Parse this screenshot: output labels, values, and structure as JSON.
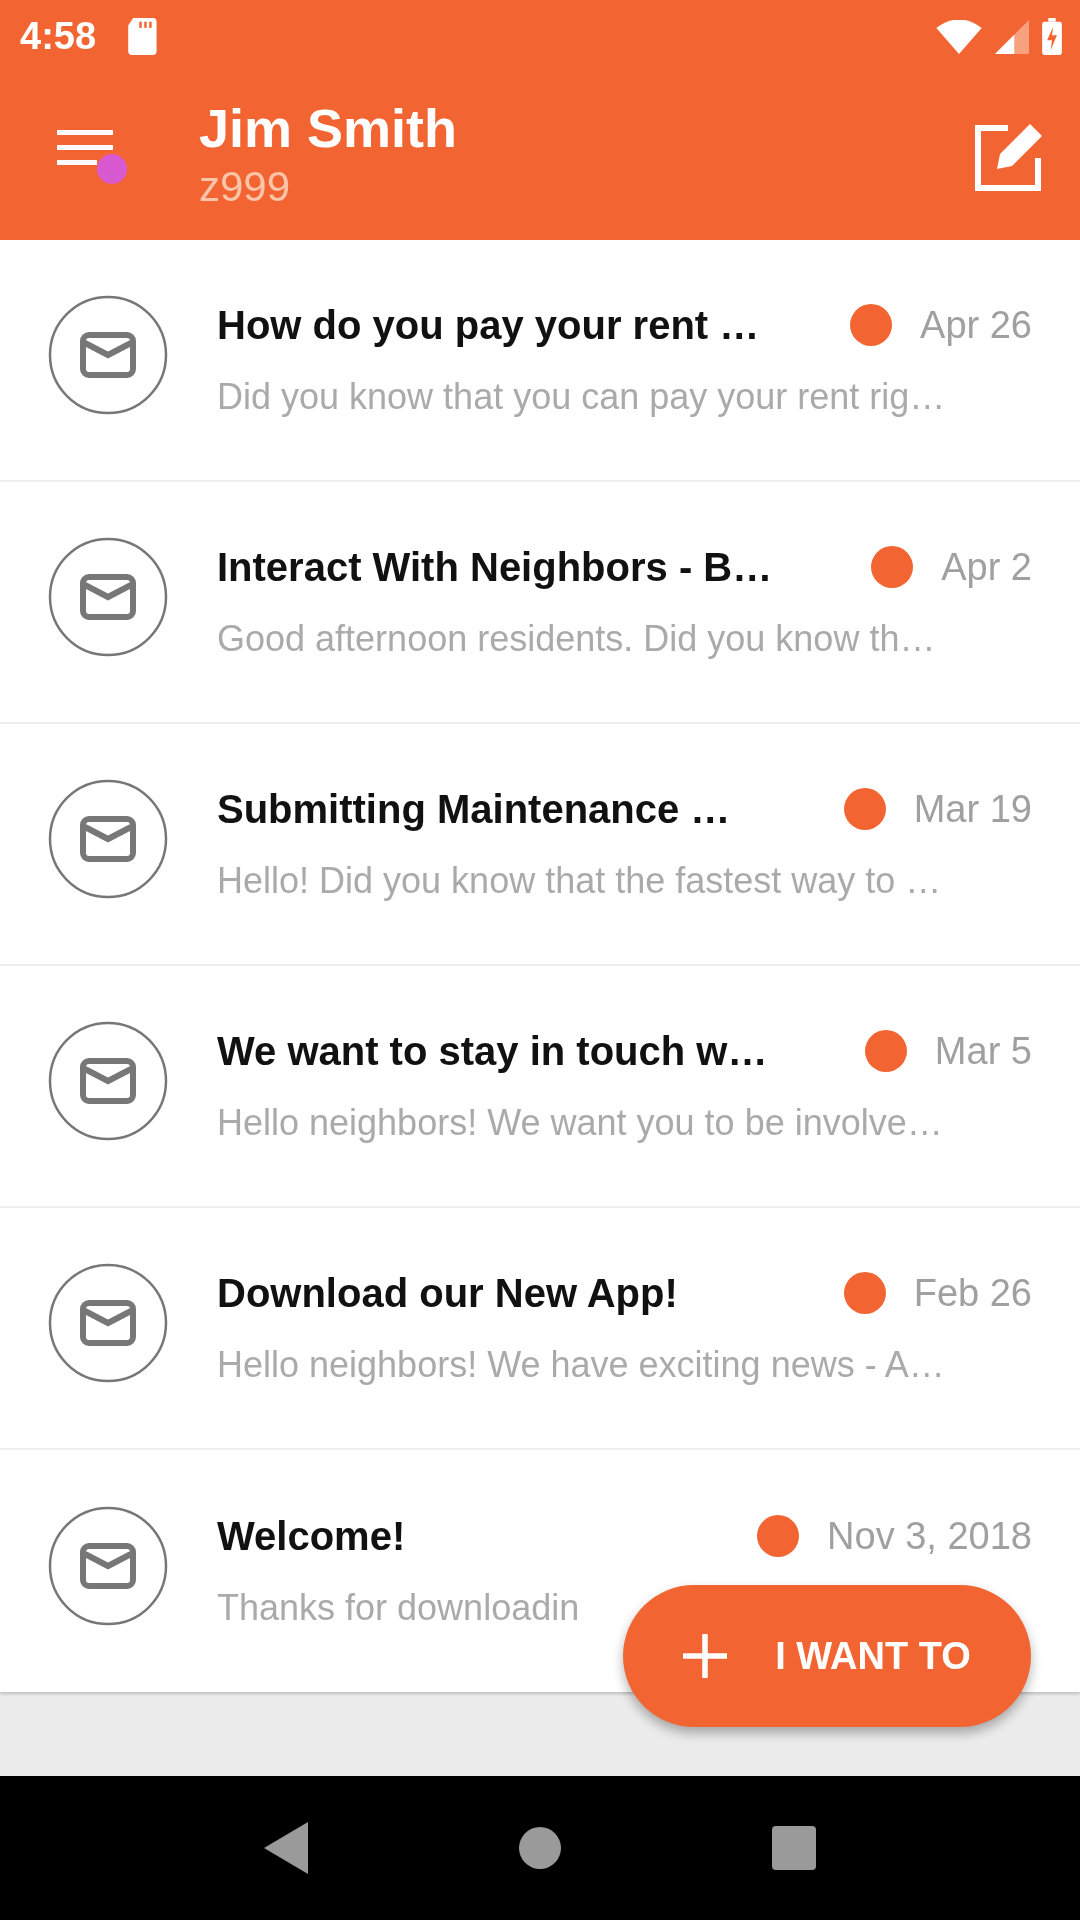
{
  "status_bar": {
    "time": "4:58"
  },
  "app_bar": {
    "title": "Jim Smith",
    "subtitle": "z999",
    "menu_badge": true
  },
  "messages": [
    {
      "title": "How do you pay your rent …",
      "date": "Apr 26",
      "preview": "Did you know that you can pay your rent rig…",
      "unread": true
    },
    {
      "title": "Interact With Neighbors - B…",
      "date": "Apr 2",
      "preview": "Good afternoon residents. Did you know th…",
      "unread": true
    },
    {
      "title": "Submitting Maintenance …",
      "date": "Mar 19",
      "preview": "Hello! Did you know that the fastest way to …",
      "unread": true
    },
    {
      "title": "We want to stay in touch w…",
      "date": "Mar 5",
      "preview": "Hello neighbors! We want you to be involve…",
      "unread": true
    },
    {
      "title": "Download our New App!",
      "date": "Feb 26",
      "preview": "Hello neighbors! We have exciting news - A…",
      "unread": true
    },
    {
      "title": "Welcome!",
      "date": "Nov 3, 2018",
      "preview": "Thanks for downloadin",
      "unread": true
    }
  ],
  "fab": {
    "label": "I WANT TO"
  }
}
